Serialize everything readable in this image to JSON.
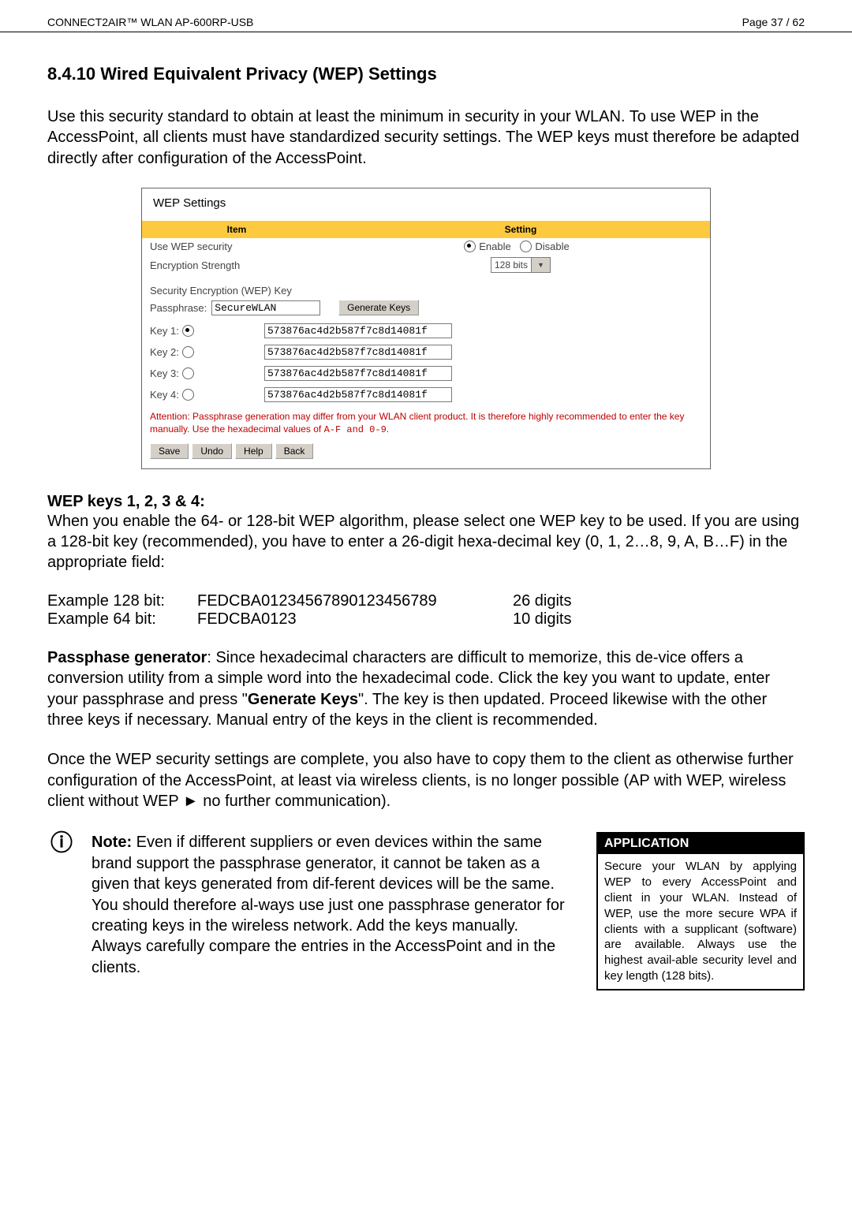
{
  "header": {
    "left": "CONNECT2AIR™ WLAN AP-600RP-USB",
    "right": "Page 37 / 62"
  },
  "section_title": "8.4.10 Wired Equivalent Privacy (WEP) Settings",
  "intro": "Use this security standard to obtain at least the minimum in security in your WLAN. To use WEP in the AccessPoint, all clients must have standardized security settings. The WEP keys must therefore be adapted directly after configuration of the AccessPoint.",
  "wep": {
    "panel_title": "WEP Settings",
    "col_item": "Item",
    "col_setting": "Setting",
    "use_wep_label": "Use WEP security",
    "enable_label": "Enable",
    "disable_label": "Disable",
    "encryption_label": "Encryption Strength",
    "encryption_value": "128 bits",
    "security_key_label": "Security Encryption (WEP) Key",
    "passphrase_label": "Passphrase:",
    "passphrase_value": "SecureWLAN",
    "generate_button": "Generate Keys",
    "keys": [
      {
        "label": "Key 1:",
        "value": "573876ac4d2b587f7c8d14081f",
        "selected": true
      },
      {
        "label": "Key 2:",
        "value": "573876ac4d2b587f7c8d14081f",
        "selected": false
      },
      {
        "label": "Key 3:",
        "value": "573876ac4d2b587f7c8d14081f",
        "selected": false
      },
      {
        "label": "Key 4:",
        "value": "573876ac4d2b587f7c8d14081f",
        "selected": false
      }
    ],
    "warning_part1": "Attention: Passphrase generation may differ from your WLAN client product. It is therefore highly recommended to enter the key manually. Use the hexadecimal values of ",
    "warning_mono": "A-F and 0-9",
    "warning_part2": ".",
    "btn_save": "Save",
    "btn_undo": "Undo",
    "btn_help": "Help",
    "btn_back": "Back"
  },
  "keys_section_title": "WEP keys 1, 2, 3 & 4:",
  "keys_para": "When you enable the 64- or 128-bit WEP algorithm, please select one WEP key to be used. If you are using a 128-bit key (recommended), you have to enter a 26-digit hexa-decimal key (0, 1, 2…8, 9, A, B…F) in the appropriate field:",
  "examples": {
    "row1": {
      "c1": "Example 128 bit:",
      "c2": "FEDCBA01234567890123456789",
      "c3": "26 digits"
    },
    "row2": {
      "c1": "Example 64 bit:",
      "c2": "FEDCBA0123",
      "c3": "10 digits"
    }
  },
  "passphase_title": "Passphase generator",
  "passphase_para": ": Since hexadecimal characters are difficult to memorize, this de-vice offers a conversion utility from a simple word into the hexadecimal code. Click the key you want to update, enter your passphrase and press \"",
  "passphase_bold2": "Generate Keys",
  "passphase_para2": "\". The key is then updated. Proceed likewise with the other three keys if necessary. Manual entry of the keys in the client is recommended.",
  "copy_para": "Once the WEP security settings are complete, you also have to copy them to the client as otherwise further configuration of the AccessPoint, at least via wireless clients, is no longer possible (AP with WEP, wireless client without WEP ► no further communication).",
  "note_icon": "ⓘ",
  "note_bold": "Note:",
  "note_text": " Even if different suppliers or even devices within the same brand support the passphrase generator, it cannot be taken as a given that keys generated from dif-ferent devices will be the same. You should therefore al-ways use just one passphrase generator for creating keys in the wireless network. Add the keys manually. Always carefully compare the entries in the AccessPoint and in the clients.",
  "application": {
    "title": "APPLICATION",
    "body": "Secure your WLAN by applying WEP to every AccessPoint and client in your WLAN. Instead of WEP, use the more secure WPA if clients with a supplicant (software) are available.\nAlways use the highest avail-able security level and key length (128 bits)."
  }
}
